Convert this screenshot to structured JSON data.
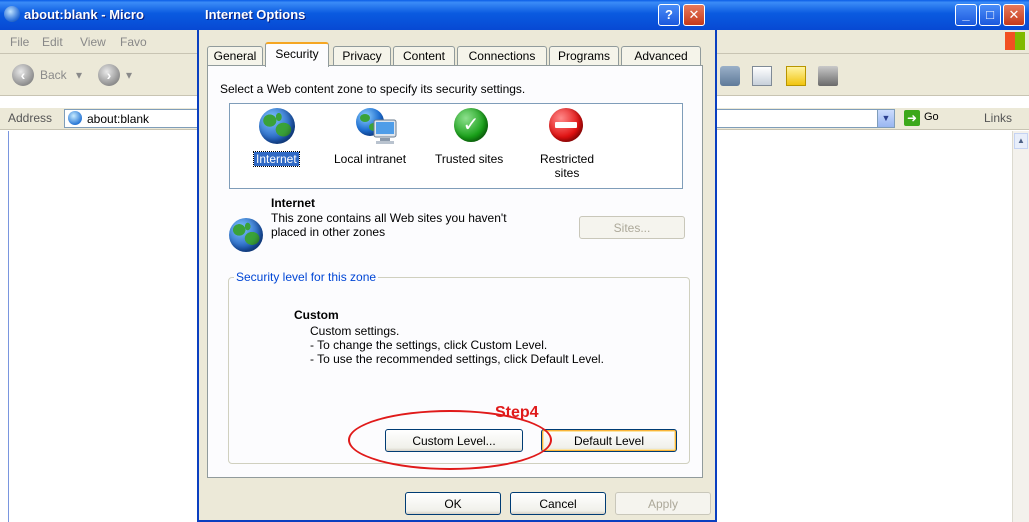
{
  "ie": {
    "title": "about:blank - Micro",
    "menu": [
      "File",
      "Edit",
      "View",
      "Favo"
    ],
    "toolbar": {
      "back_label": "Back"
    },
    "address": {
      "label": "Address",
      "value": "about:blank",
      "go_label": "Go",
      "links_label": "Links"
    }
  },
  "dialog": {
    "title": "Internet Options",
    "help_glyph": "?",
    "close_glyph": "✕",
    "tabs": [
      {
        "label": "General"
      },
      {
        "label": "Security"
      },
      {
        "label": "Privacy"
      },
      {
        "label": "Content"
      },
      {
        "label": "Connections"
      },
      {
        "label": "Programs"
      },
      {
        "label": "Advanced"
      }
    ],
    "active_tab": "Security",
    "instruction": "Select a Web content zone to specify its security settings.",
    "zones": [
      {
        "label": "Internet",
        "icon": "globe-icon",
        "selected": true
      },
      {
        "label": "Local intranet",
        "icon": "monitor-globe-icon",
        "selected": false
      },
      {
        "label": "Trusted sites",
        "icon": "check-icon",
        "selected": false
      },
      {
        "label": "Restricted sites",
        "icon": "no-entry-icon",
        "selected": false
      }
    ],
    "zone_info": {
      "title": "Internet",
      "description": "This zone contains all Web sites you haven't placed in other zones",
      "sites_button": "Sites..."
    },
    "security_level": {
      "group_label": "Security level for this zone",
      "level_name": "Custom",
      "description_lines": [
        "Custom settings.",
        "- To change the settings, click Custom Level.",
        "- To use the recommended settings, click Default Level."
      ],
      "custom_level_button": "Custom Level...",
      "default_level_button": "Default Level"
    },
    "annotation": {
      "step_label": "Step4",
      "color": "#e01a1a"
    },
    "footer": {
      "ok": "OK",
      "cancel": "Cancel",
      "apply": "Apply"
    }
  }
}
